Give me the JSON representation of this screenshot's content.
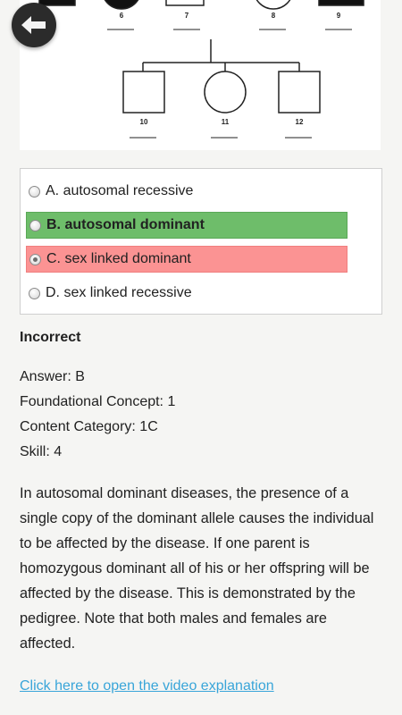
{
  "pedigree": {
    "top_individuals": [
      "6",
      "7",
      "8",
      "9"
    ],
    "children": [
      "10",
      "11",
      "12"
    ]
  },
  "back_button": {
    "icon": "back-arrow-icon"
  },
  "options": [
    {
      "label": "A. autosomal recessive",
      "state": "normal",
      "checked": false
    },
    {
      "label": "B. autosomal dominant",
      "state": "correct",
      "checked": false
    },
    {
      "label": "C. sex linked dominant",
      "state": "incorrect",
      "checked": true
    },
    {
      "label": "D. sex linked recessive",
      "state": "normal",
      "checked": false
    }
  ],
  "result": "Incorrect",
  "meta": {
    "answer": "Answer: B",
    "foundational_concept": "Foundational Concept: 1",
    "content_category": "Content Category: 1C",
    "skill": "Skill: 4"
  },
  "explanation": "In autosomal dominant diseases, the presence of a single copy of the dominant allele causes the individual to be affected by the disease. If one parent is homozygous dominant all of his or her offspring will be affected by the disease. This is demonstrated by the pedigree. Note that both males and females are affected.",
  "video_link": "Click here to open the video explanation",
  "colors": {
    "correct": "#6ebd6a",
    "incorrect": "#fb9393",
    "link": "#39a5d9"
  }
}
